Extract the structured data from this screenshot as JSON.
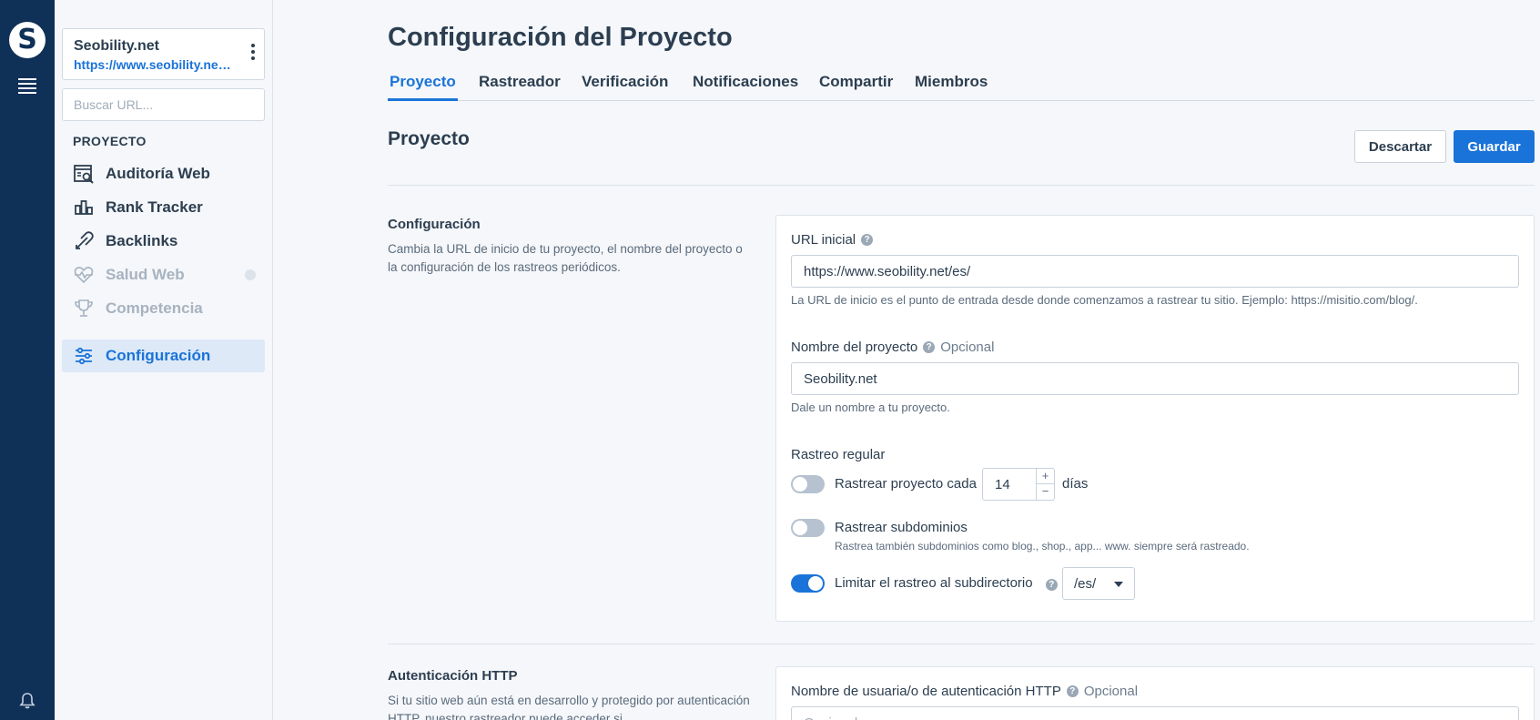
{
  "rail": {
    "logo_letter": "S",
    "icons": [
      "seobility-logo-icon",
      "menu-icon",
      "bell-icon"
    ]
  },
  "sidebar": {
    "project_name": "Seobility.net",
    "project_url": "https://www.seobility.net/es/",
    "search_placeholder": "Buscar URL...",
    "section_label": "PROYECTO",
    "items": [
      {
        "label": "Auditoría Web",
        "icon": "site-audit-icon",
        "state": "normal"
      },
      {
        "label": "Rank Tracker",
        "icon": "rank-tracker-icon",
        "state": "normal"
      },
      {
        "label": "Backlinks",
        "icon": "backlinks-icon",
        "state": "normal"
      },
      {
        "label": "Salud Web",
        "icon": "heartbeat-icon",
        "state": "disabled"
      },
      {
        "label": "Competencia",
        "icon": "trophy-icon",
        "state": "disabled"
      },
      {
        "label": "Configuración",
        "icon": "sliders-icon",
        "state": "active"
      }
    ]
  },
  "main": {
    "title": "Configuración del Proyecto",
    "tabs": [
      {
        "label": "Proyecto",
        "active": true
      },
      {
        "label": "Rastreador",
        "active": false
      },
      {
        "label": "Verificación",
        "active": false
      },
      {
        "label": "Notificaciones",
        "active": false
      },
      {
        "label": "Compartir",
        "active": false
      },
      {
        "label": "Miembros",
        "active": false
      }
    ],
    "section_title": "Proyecto",
    "discard_label": "Descartar",
    "save_label": "Guardar",
    "accent_color": "#1a73d9"
  },
  "config_block": {
    "title": "Configuración",
    "description": "Cambia la URL de inicio de tu proyecto, el nombre del proyecto o la configuración de los rastreos periódicos.",
    "start_url_label": "URL inicial",
    "start_url_value": "https://www.seobility.net/es/",
    "start_url_help": "La URL de inicio es el punto de entrada desde donde comenzamos a rastrear tu sitio. Ejemplo: https://misitio.com/blog/.",
    "project_name_label": "Nombre del proyecto",
    "optional_label": "Opcional",
    "project_name_value": "Seobility.net",
    "project_name_help": "Dale un nombre a tu proyecto.",
    "regular_crawl_label": "Rastreo regular",
    "crawl_every_label": "Rastrear proyecto cada",
    "crawl_every_value": "14",
    "crawl_every_unit": "días",
    "crawl_every_on": false,
    "subdomains_label": "Rastrear subdominios",
    "subdomains_help": "Rastrea también subdominios como blog., shop., app... www. siempre será rastreado.",
    "subdomains_on": false,
    "limit_subdir_label": "Limitar el rastreo al subdirectorio",
    "limit_subdir_on": true,
    "subdir_value": "/es/"
  },
  "auth_block": {
    "title": "Autenticación HTTP",
    "description": "Si tu sitio web aún está en desarrollo y protegido por autenticación HTTP, nuestro rastreador puede acceder si",
    "username_label": "Nombre de usuaria/o de autenticación HTTP",
    "optional_label": "Opcional",
    "username_placeholder": "Opcional"
  }
}
